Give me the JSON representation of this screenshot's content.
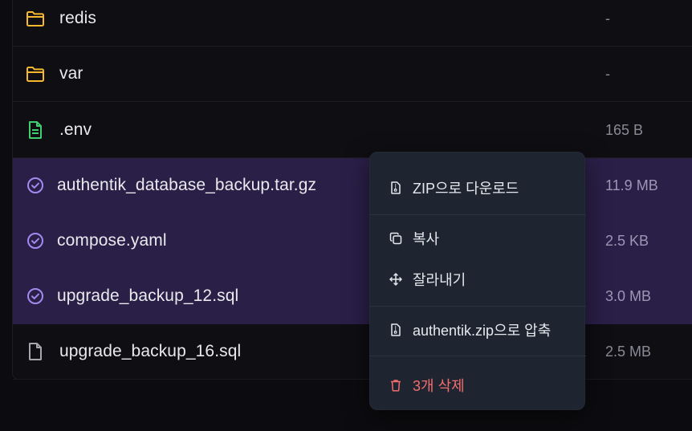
{
  "files": [
    {
      "name": "redis",
      "size": "-",
      "type": "folder",
      "selected": false
    },
    {
      "name": "var",
      "size": "-",
      "type": "folder",
      "selected": false
    },
    {
      "name": ".env",
      "size": "165 B",
      "type": "file-green",
      "selected": false
    },
    {
      "name": "authentik_database_backup.tar.gz",
      "size": "11.9 MB",
      "type": "check",
      "selected": true
    },
    {
      "name": "compose.yaml",
      "size": "2.5 KB",
      "type": "check",
      "selected": true
    },
    {
      "name": "upgrade_backup_12.sql",
      "size": "3.0 MB",
      "type": "check",
      "selected": true
    },
    {
      "name": "upgrade_backup_16.sql",
      "size": "2.5 MB",
      "type": "file",
      "selected": false
    }
  ],
  "context_menu": {
    "download_zip": "ZIP으로 다운로드",
    "copy": "복사",
    "cut": "잘라내기",
    "compress": "authentik.zip으로 압축",
    "delete": "3개 삭제"
  },
  "colors": {
    "folder": "#f5b82e",
    "env_file": "#3fcf6e",
    "check": "#a18bf0",
    "selected_row": "#2a1f47",
    "danger": "#f26d6d"
  }
}
